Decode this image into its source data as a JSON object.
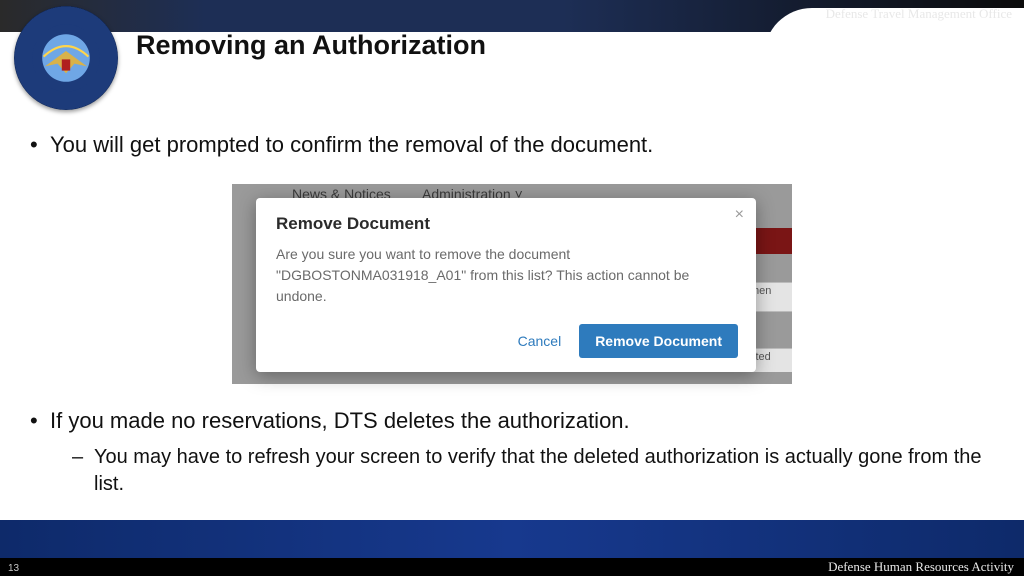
{
  "header": {
    "office": "Defense Travel Management Office",
    "title": "Removing an Authorization"
  },
  "bullets": {
    "b1": "You will get prompted to confirm the removal of the document.",
    "b2": "If you made no reservations, DTS deletes the authorization.",
    "b2_sub1": "You may have to refresh your screen to verify that the deleted authorization is actually gone from the list."
  },
  "screenshot": {
    "bg_nav1": "News & Notices",
    "bg_nav2": "Administration ˅",
    "bg_peek1": "men",
    "bg_peek2": "itted",
    "dialog": {
      "title": "Remove Document",
      "body": "Are you sure you want to remove the document \"DGBOSTONMA031918_A01\" from this list? This action cannot be undone.",
      "cancel": "Cancel",
      "confirm": "Remove Document",
      "close_glyph": "×"
    }
  },
  "footer": {
    "page": "13",
    "agency": "Defense Human Resources Activity"
  }
}
